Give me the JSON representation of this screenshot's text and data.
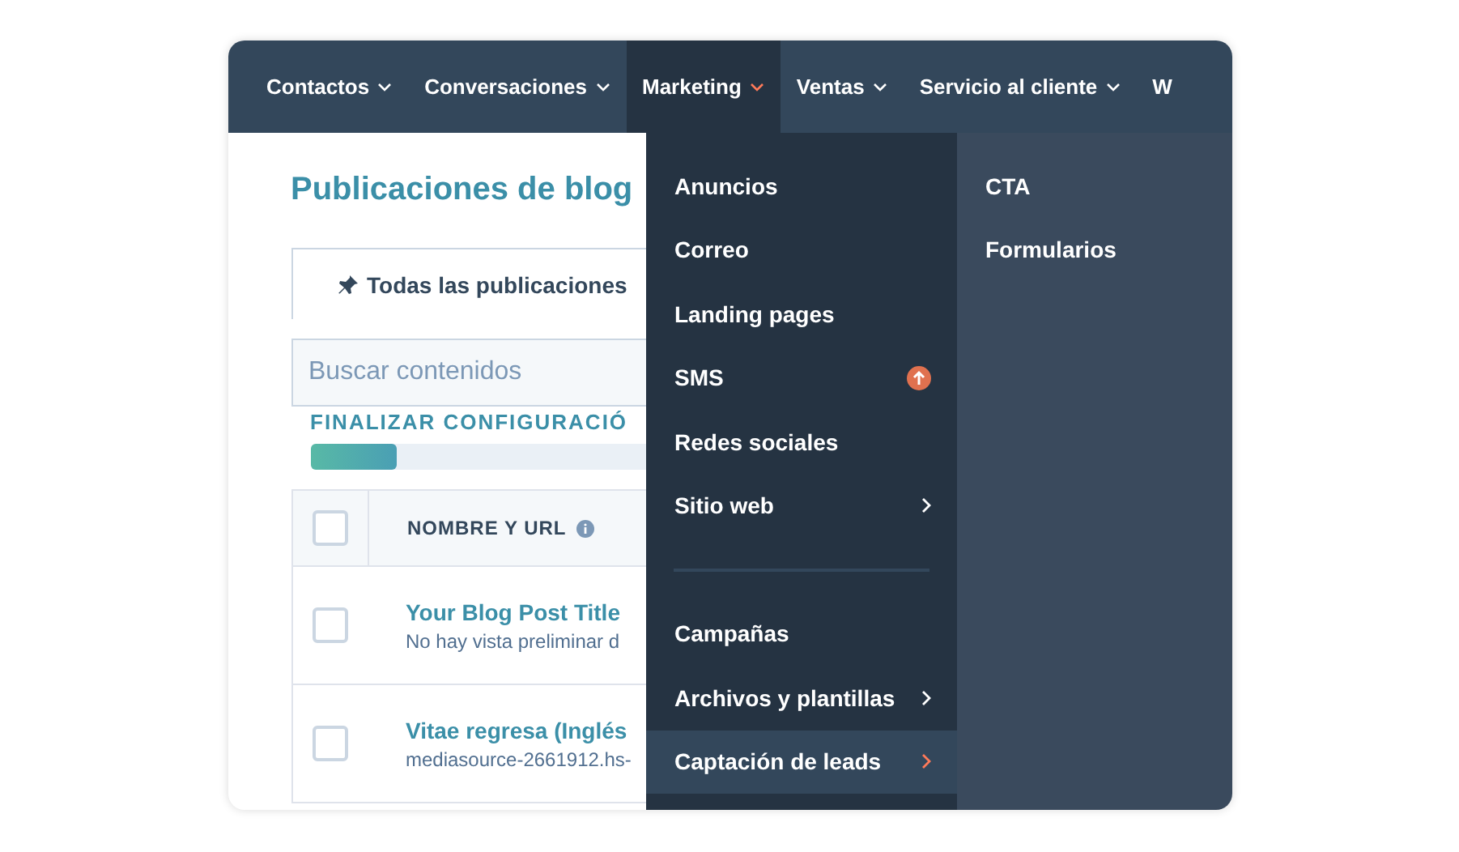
{
  "nav": [
    {
      "label": "Contactos",
      "selected": false,
      "caret": true
    },
    {
      "label": "Conversaciones",
      "selected": false,
      "caret": true
    },
    {
      "label": "Marketing",
      "selected": true,
      "caret": true
    },
    {
      "label": "Ventas",
      "selected": false,
      "caret": true
    },
    {
      "label": "Servicio al cliente",
      "selected": false,
      "caret": true
    },
    {
      "label": "W",
      "selected": false,
      "caret": false
    }
  ],
  "page": {
    "title": "Publicaciones de blog",
    "tab": {
      "label": "Todas las publicaciones"
    },
    "search": {
      "placeholder": "Buscar contenidos"
    },
    "setup": {
      "label": "FINALIZAR CONFIGURACIÓ",
      "level": 0.26
    },
    "table": {
      "header": {
        "checked": false,
        "column": "NOMBRE Y URL"
      },
      "rows": [
        {
          "checked": false,
          "title": "Your Blog Post Title",
          "subtitle": "No hay vista preliminar d"
        },
        {
          "checked": false,
          "title": "Vitae regresa (Inglés",
          "subtitle": "mediasource-2661912.hs-"
        }
      ]
    }
  },
  "menu": {
    "items": [
      {
        "kind": "item",
        "label": "Anuncios",
        "selected": false,
        "submenu": false,
        "badge": false
      },
      {
        "kind": "item",
        "label": "Correo",
        "selected": false,
        "submenu": false,
        "badge": false
      },
      {
        "kind": "item",
        "label": "Landing pages",
        "selected": false,
        "submenu": false,
        "badge": false
      },
      {
        "kind": "item",
        "label": "SMS",
        "selected": false,
        "submenu": false,
        "badge": true
      },
      {
        "kind": "item",
        "label": "Redes sociales",
        "selected": false,
        "submenu": false,
        "badge": false
      },
      {
        "kind": "item",
        "label": "Sitio web",
        "selected": false,
        "submenu": true,
        "badge": false
      },
      {
        "kind": "divider"
      },
      {
        "kind": "item",
        "label": "Campañas",
        "selected": false,
        "submenu": false,
        "badge": false
      },
      {
        "kind": "item",
        "label": "Archivos y plantillas",
        "selected": false,
        "submenu": true,
        "badge": false
      },
      {
        "kind": "item",
        "label": "Captación de leads",
        "selected": true,
        "submenu": true,
        "badge": false
      }
    ],
    "submenu": [
      {
        "label": "CTA"
      },
      {
        "label": "Formularios"
      }
    ]
  }
}
